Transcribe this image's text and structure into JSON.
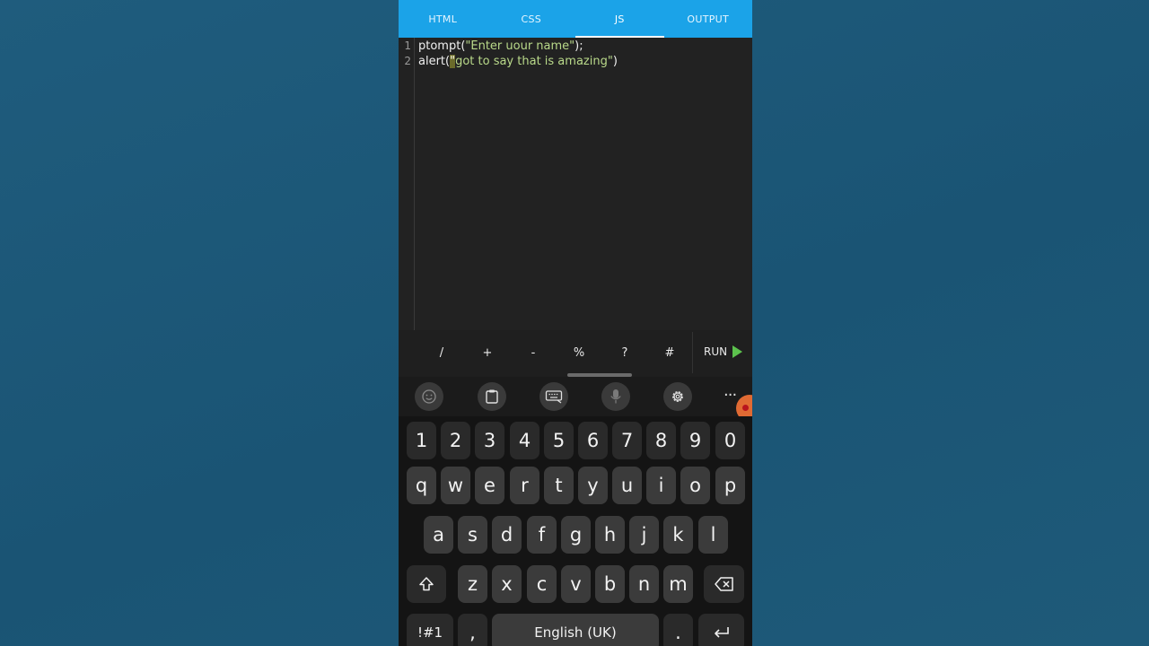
{
  "tabs": [
    {
      "label": "HTML"
    },
    {
      "label": "CSS"
    },
    {
      "label": "JS",
      "active": true
    },
    {
      "label": "OUTPUT"
    }
  ],
  "editor": {
    "lines": [
      {
        "number": "1",
        "before": "ptompt(",
        "string": "\"Enter uour name\"",
        "after": ");"
      },
      {
        "number": "2",
        "before": "alert(",
        "cursor": "\"",
        "string": "got to say that is amazing\"",
        "after": ")"
      }
    ]
  },
  "symbols": [
    "/",
    "+",
    "-",
    "%",
    "?",
    "#"
  ],
  "run_label": "RUN",
  "toolbar_icons": [
    "emoji-icon",
    "clipboard-icon",
    "keyboard-mode-icon",
    "microphone-icon",
    "settings-gear-icon"
  ],
  "more_label": "···",
  "keyboard": {
    "row_numbers": [
      "1",
      "2",
      "3",
      "4",
      "5",
      "6",
      "7",
      "8",
      "9",
      "0"
    ],
    "row_q": [
      "q",
      "w",
      "e",
      "r",
      "t",
      "y",
      "u",
      "i",
      "o",
      "p"
    ],
    "row_a": [
      "a",
      "s",
      "d",
      "f",
      "g",
      "h",
      "j",
      "k",
      "l"
    ],
    "row_z": [
      "z",
      "x",
      "c",
      "v",
      "b",
      "n",
      "m"
    ],
    "sym_key": "!#1",
    "comma": ",",
    "space_label": "English (UK)",
    "period": "."
  },
  "colors": {
    "background": "#1d5677",
    "tabbar": "#1ba3e8",
    "editor": "#222222",
    "string": "#b9d98a",
    "run_icon": "#5cc24d"
  }
}
